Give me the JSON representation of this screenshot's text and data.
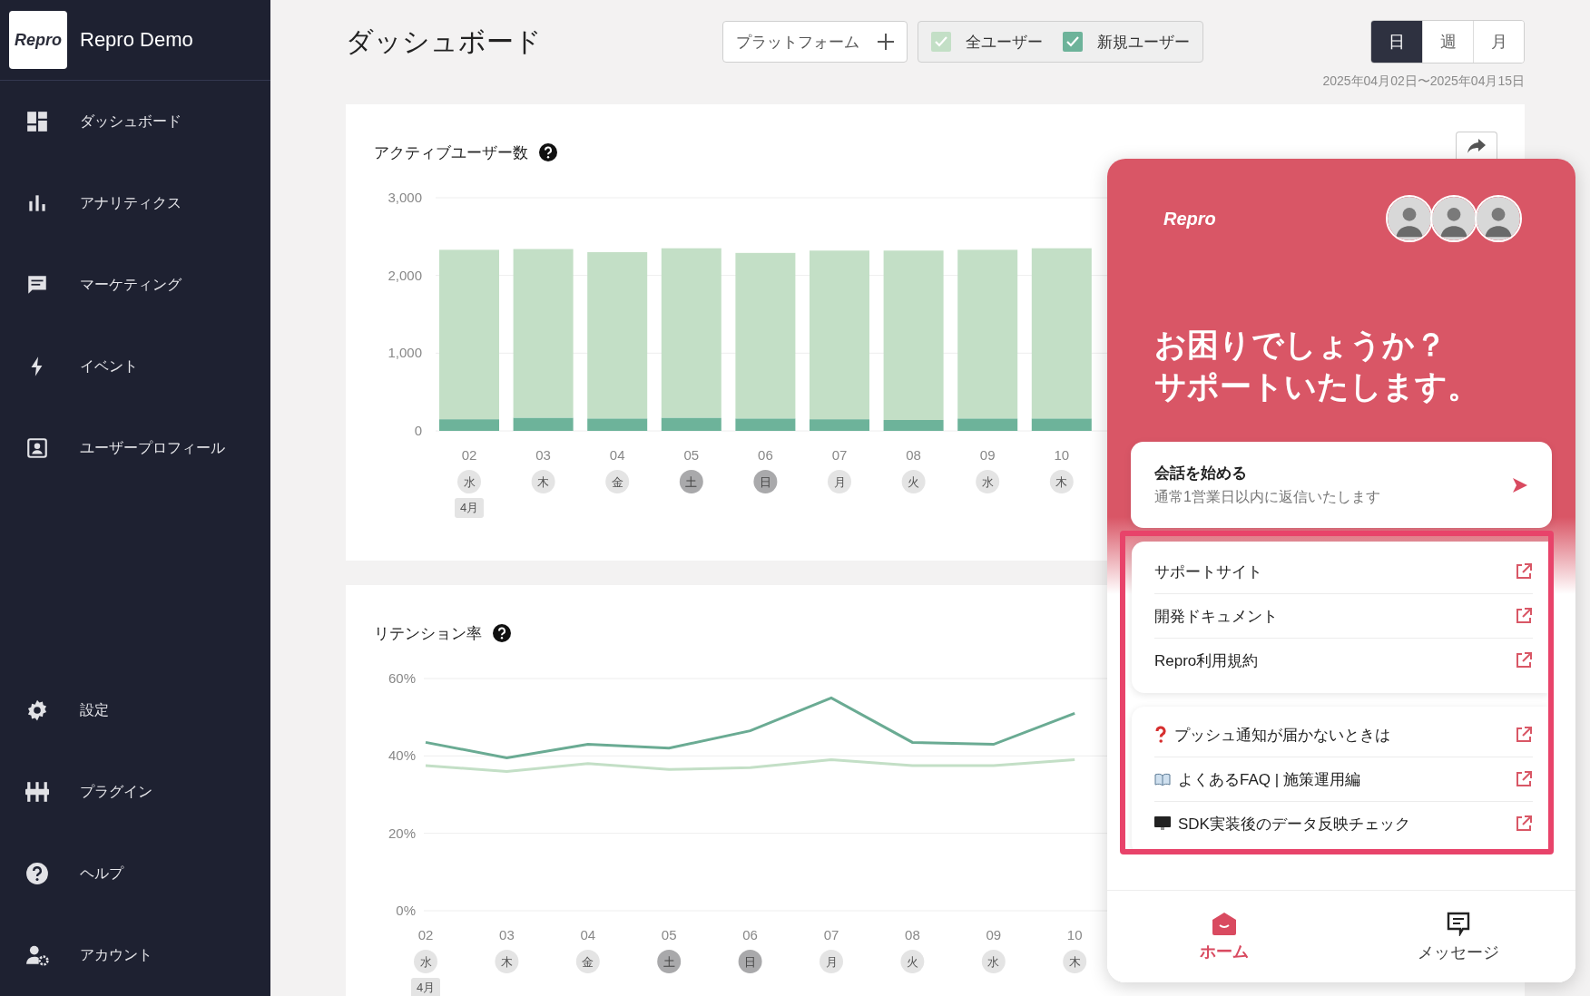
{
  "sidebar": {
    "logo": "Repro",
    "app_name": "Repro Demo",
    "items": [
      {
        "label": "ダッシュボード"
      },
      {
        "label": "アナリティクス"
      },
      {
        "label": "マーケティング"
      },
      {
        "label": "イベント"
      },
      {
        "label": "ユーザープロフィール"
      }
    ],
    "bottom_items": [
      {
        "label": "設定"
      },
      {
        "label": "プラグイン"
      },
      {
        "label": "ヘルプ"
      },
      {
        "label": "アカウント"
      }
    ]
  },
  "header": {
    "title": "ダッシュボード",
    "platform_button": "プラットフォーム",
    "series_toggles": [
      {
        "label": "全ユーザー",
        "checked": true,
        "color": "#c3dfc6"
      },
      {
        "label": "新規ユーザー",
        "checked": true,
        "color": "#6db39a"
      }
    ],
    "periods": [
      {
        "label": "日",
        "selected": true
      },
      {
        "label": "週",
        "selected": false
      },
      {
        "label": "月",
        "selected": false
      }
    ],
    "date_range": "2025年04月02日〜2025年04月15日"
  },
  "active_users": {
    "title": "アクティブユーザー数",
    "month_label": "4月",
    "day_labels": [
      {
        "label": "水",
        "weekend": false
      },
      {
        "label": "木",
        "weekend": false
      },
      {
        "label": "金",
        "weekend": false
      },
      {
        "label": "土",
        "weekend": true
      },
      {
        "label": "日",
        "weekend": true
      },
      {
        "label": "月",
        "weekend": false
      },
      {
        "label": "火",
        "weekend": false
      },
      {
        "label": "水",
        "weekend": false
      },
      {
        "label": "木",
        "weekend": false
      }
    ],
    "chart_data": {
      "type": "bar",
      "stacked": true,
      "categories": [
        "02",
        "03",
        "04",
        "05",
        "06",
        "07",
        "08",
        "09",
        "10"
      ],
      "ylim": [
        0,
        3000
      ],
      "yticks": [
        {
          "value": 0,
          "label": "0"
        },
        {
          "value": 1000,
          "label": "1,000"
        },
        {
          "value": 2000,
          "label": "2,000"
        },
        {
          "value": 3000,
          "label": "3,000"
        }
      ],
      "series": [
        {
          "color": "#6db39a",
          "values": [
            150,
            170,
            160,
            170,
            160,
            150,
            140,
            160,
            160
          ]
        },
        {
          "color": "#c3dfc6",
          "values": [
            2180,
            2170,
            2140,
            2180,
            2130,
            2170,
            2180,
            2170,
            2190
          ]
        }
      ]
    }
  },
  "retention": {
    "title": "リテンション率",
    "month_label": "4月",
    "day_labels": [
      {
        "label": "水",
        "weekend": false
      },
      {
        "label": "木",
        "weekend": false
      },
      {
        "label": "金",
        "weekend": false
      },
      {
        "label": "土",
        "weekend": true
      },
      {
        "label": "日",
        "weekend": true
      },
      {
        "label": "月",
        "weekend": false
      },
      {
        "label": "火",
        "weekend": false
      },
      {
        "label": "水",
        "weekend": false
      },
      {
        "label": "木",
        "weekend": false
      }
    ],
    "chart_data": {
      "type": "line",
      "categories": [
        "02",
        "03",
        "04",
        "05",
        "06",
        "07",
        "08",
        "09",
        "10"
      ],
      "ylim": [
        0,
        60
      ],
      "yticks": [
        {
          "value": 0,
          "label": "0%"
        },
        {
          "value": 20,
          "label": "20%"
        },
        {
          "value": 40,
          "label": "40%"
        },
        {
          "value": 60,
          "label": "60%"
        }
      ],
      "series": [
        {
          "color": "#6aab93",
          "values": [
            43.5,
            39.5,
            43,
            42,
            46.5,
            55,
            43.5,
            43,
            51
          ]
        },
        {
          "color": "#c3dfc6",
          "values": [
            37.5,
            36,
            38,
            36.5,
            37,
            39,
            37.5,
            37.5,
            39
          ]
        }
      ]
    }
  },
  "support_widget": {
    "logo": "Repro",
    "heading": [
      "お困りでしょうか？",
      "サポートいたします。"
    ],
    "conversation": {
      "title": "会話を始める",
      "subtitle": "通常1営業日以内に返信いたします"
    },
    "link_groups": [
      {
        "links": [
          {
            "label": "サポートサイト"
          },
          {
            "label": "開発ドキュメント"
          },
          {
            "label": "Repro利用規約"
          }
        ]
      },
      {
        "links": [
          {
            "label": "プッシュ通知が届かないときは"
          },
          {
            "label": "よくあるFAQ | 施策運用編"
          },
          {
            "label": "SDK実装後のデータ反映チェック"
          }
        ]
      }
    ],
    "tabs": [
      {
        "label": "ホーム",
        "selected": true
      },
      {
        "label": "メッセージ",
        "selected": false
      }
    ]
  }
}
